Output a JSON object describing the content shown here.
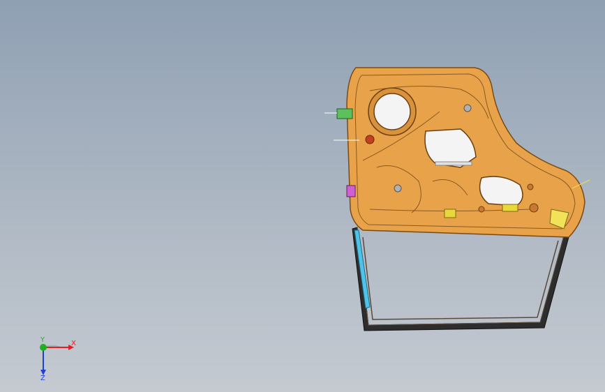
{
  "viewport": {
    "background_top": "#8fa0b3",
    "background_bottom": "#c5cad1"
  },
  "model": {
    "description_icon": "car-door-assembly-icon",
    "panel_color": "#e8a24a",
    "frame_color": "#3a3a3a",
    "glass_channel_color": "#4fc3e8"
  },
  "triad": {
    "x_label": "X",
    "y_label": "Y",
    "z_label": "Z",
    "x_color": "#e02020",
    "y_color": "#20b020",
    "z_color": "#2040d0"
  }
}
